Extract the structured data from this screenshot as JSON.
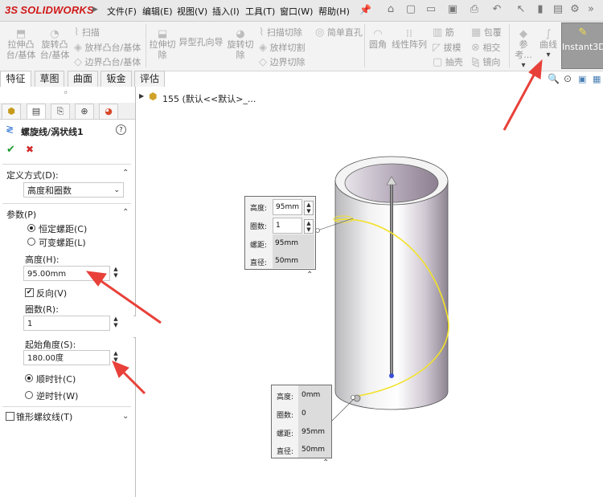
{
  "app": {
    "logo_text": "SOLIDWORKS",
    "logo_prefix": "3S"
  },
  "menu": [
    "文件(F)",
    "编辑(E)",
    "视图(V)",
    "插入(I)",
    "工具(T)",
    "窗口(W)",
    "帮助(H)"
  ],
  "commands": {
    "extrude_boss": "拉伸凸\n台/基体",
    "revolve_boss": "旋转凸\n台/基体",
    "sweep": "扫描",
    "loft_boss": "放样凸台/基体",
    "boundary_boss": "边界凸台/基体",
    "extrude_cut": "拉伸切\n除",
    "hole_wizard": "异型孔向导",
    "revolve_cut": "旋转切\n除",
    "sweep_cut": "扫描切除",
    "loft_cut": "放样切割",
    "boundary_cut": "边界切除",
    "simple_hole": "简单直孔",
    "fillet": "圆角",
    "linear_pattern": "线性阵列",
    "rib": "筋",
    "draft": "拔模",
    "shell": "抽壳",
    "wrap": "包覆",
    "intersect": "相交",
    "mirror": "镜向",
    "reference": "参考...",
    "curves": "曲线",
    "instant3d": "Instant3D"
  },
  "tabs": [
    "特征",
    "草图",
    "曲面",
    "钣金",
    "评估"
  ],
  "feature_tree": {
    "item": "155 (默认<<默认>_..."
  },
  "property_manager": {
    "title": "螺旋线/涡状线1",
    "ok": "✔",
    "cancel": "✖",
    "help": "?",
    "definition_section": "定义方式(D):",
    "definition_value": "高度和圈数",
    "params_section": "参数(P)",
    "constant_pitch": "恒定螺距(C)",
    "variable_pitch": "可变螺距(L)",
    "height_label": "高度(H):",
    "height_value": "95.00mm",
    "reverse_label": "反向(V)",
    "revolutions_label": "圈数(R):",
    "revolutions_value": "1",
    "start_angle_label": "起始角度(S):",
    "start_angle_value": "180.00度",
    "clockwise": "顺时针(C)",
    "counterclockwise": "逆时针(W)",
    "tapered_section": "锥形螺纹线(T)"
  },
  "callout_top": {
    "rows": [
      {
        "label": "高度:",
        "value": "95mm"
      },
      {
        "label": "圈数:",
        "value": "1"
      },
      {
        "label": "螺距:",
        "value": "95mm"
      },
      {
        "label": "直径:",
        "value": "50mm"
      }
    ]
  },
  "callout_bottom": {
    "rows": [
      {
        "label": "高度:",
        "value": "0mm"
      },
      {
        "label": "圈数:",
        "value": "0"
      },
      {
        "label": "螺距:",
        "value": "95mm"
      },
      {
        "label": "直径:",
        "value": "50mm"
      }
    ]
  },
  "colors": {
    "helix": "#f2e22a",
    "arrow": "#e8413a",
    "cylinder_inner": "#a99cab"
  }
}
